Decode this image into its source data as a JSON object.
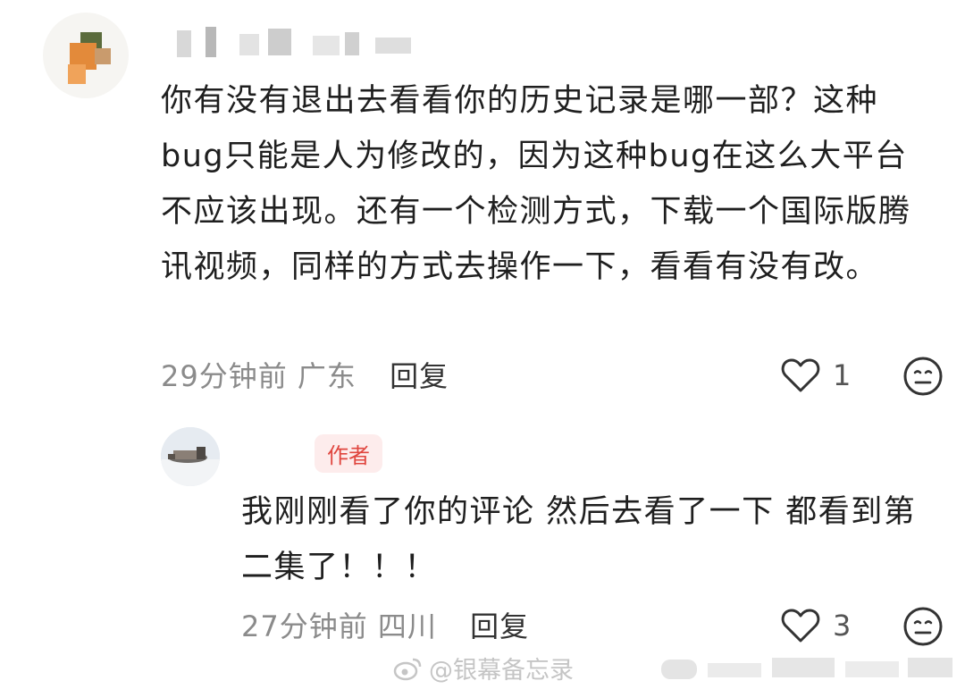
{
  "comment": {
    "text": "你有没有退出去看看你的历史记录是哪一部？这种 bug只能是人为修改的，因为这种bug在这么大平台不应该出现。还有一个检测方式，下载一个国际版腾讯视频，同样的方式去操作一下，看看有没有改。",
    "time": "29分钟前",
    "location": "广东",
    "reply_label": "回复",
    "likes": "1"
  },
  "reply": {
    "badge": "作者",
    "text": "我刚刚看了你的评论 然后去看了一下 都看到第二集了！！！",
    "time": "27分钟前",
    "location": "四川",
    "reply_label": "回复",
    "likes": "3"
  },
  "watermark": {
    "left": "@银幕备忘录"
  },
  "icons": {
    "like": "heart-outline-icon",
    "emoji": "neutral-face-icon"
  }
}
